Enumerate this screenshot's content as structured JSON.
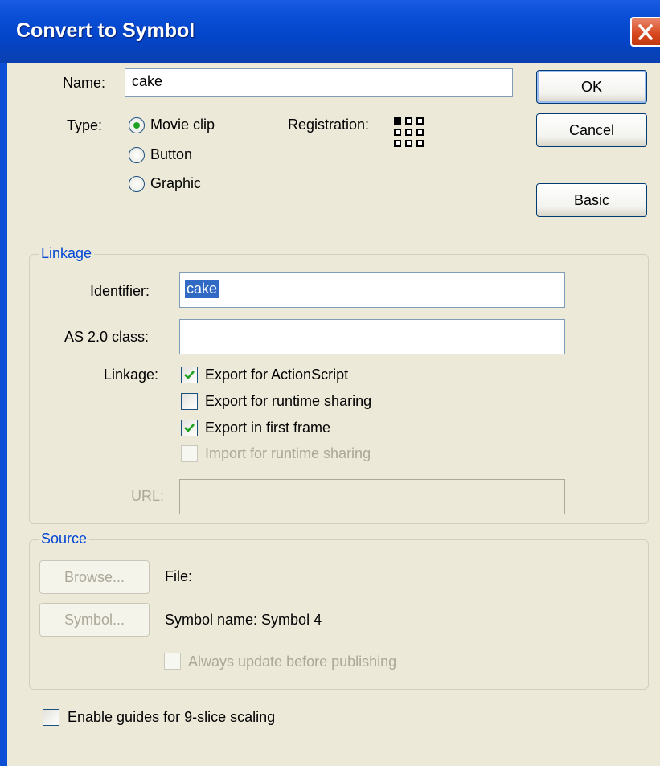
{
  "window": {
    "title": "Convert to Symbol",
    "accent": "#0a4fd6"
  },
  "name": {
    "label": "Name:",
    "value": "cake"
  },
  "type": {
    "label": "Type:",
    "options": [
      {
        "label": "Movie clip",
        "selected": true
      },
      {
        "label": "Button",
        "selected": false
      },
      {
        "label": "Graphic",
        "selected": false
      }
    ]
  },
  "registration": {
    "label": "Registration:",
    "selected_point": "top-left"
  },
  "buttons": {
    "ok": "OK",
    "cancel": "Cancel",
    "basic": "Basic"
  },
  "linkage": {
    "legend": "Linkage",
    "identifier_label": "Identifier:",
    "identifier_value": "cake",
    "as_class_label": "AS 2.0 class:",
    "as_class_value": "",
    "linkage_label": "Linkage:",
    "options": [
      {
        "label": "Export for ActionScript",
        "checked": true,
        "enabled": true
      },
      {
        "label": "Export for runtime sharing",
        "checked": false,
        "enabled": true
      },
      {
        "label": "Export in first frame",
        "checked": true,
        "enabled": true
      },
      {
        "label": "Import for runtime sharing",
        "checked": false,
        "enabled": false
      }
    ],
    "url_label": "URL:",
    "url_value": ""
  },
  "source": {
    "legend": "Source",
    "browse": "Browse...",
    "file_label": "File:",
    "symbol": "Symbol...",
    "symbol_name": "Symbol name: Symbol 4",
    "always_update": "Always update before publishing"
  },
  "nine_slice": {
    "label": "Enable guides for 9-slice scaling",
    "checked": false
  }
}
